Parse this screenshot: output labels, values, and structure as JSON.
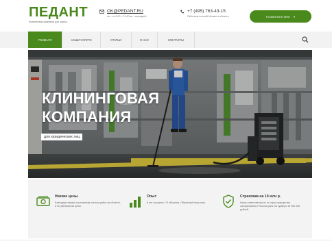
{
  "header": {
    "logo": "ПЕДАНТ",
    "logo_tagline": "Клининговая компания для офиса",
    "email": "OK@PEDANT.RU",
    "email_sub": "пн – пт 9:00 – 21:00 вс – выходной",
    "phone": "+7 (495) 763-43-15",
    "phone_sub": "Работаем по всей Москве и области",
    "callback_label": "ПОЗВОНИТЕ МНЕ",
    "accent_color": "#4a8a1c"
  },
  "nav": {
    "items": [
      {
        "label": "ГЛАВНАЯ"
      },
      {
        "label": "НАШИ УСЛУГИ"
      },
      {
        "label": "СТАТЬИ"
      },
      {
        "label": "О НАС"
      },
      {
        "label": "КОНТАКТЫ"
      }
    ],
    "active_index": 0
  },
  "hero": {
    "title_line1": "КЛИНИНГОВАЯ",
    "title_line2": "КОМПАНИЯ",
    "subtitle": "для юридических лиц"
  },
  "features": [
    {
      "icon": "money-icon",
      "title": "Низкие цены",
      "desc": "Благодаря нашим постоянным опытом работ на объекте, а не увеличению цены."
    },
    {
      "icon": "chart-icon",
      "title": "Опыт",
      "desc": "8 лет на рынке. 78 объектов. Обученный персонал."
    },
    {
      "icon": "shield-icon",
      "title": "Страховка на 10 млн р.",
      "desc": "Наша ответственность от порчи имущества застрахована в Росгосстрахе на сумму в 10 000 000 рублей."
    }
  ]
}
